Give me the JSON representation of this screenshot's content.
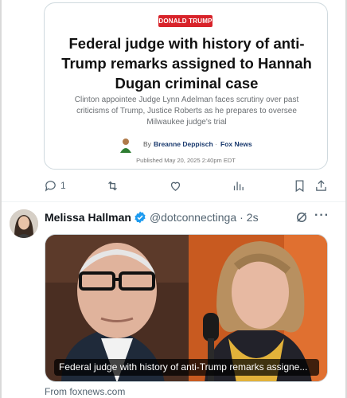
{
  "article": {
    "badge": "DONALD TRUMP",
    "headline": "Federal judge with history of anti-Trump remarks assigned to Hannah Dugan criminal case",
    "dek": "Clinton appointee Judge Lynn Adelman faces scrutiny over past criticisms of Trump, Justice Roberts as he prepares to oversee Milwaukee judge's trial",
    "by": "By",
    "author": "Breanne Deppisch",
    "separator": "·",
    "outlet": "Fox News",
    "published": "Published May 20, 2025 2:40pm EDT"
  },
  "actions": {
    "reply_count": "1",
    "icons": [
      "reply-icon",
      "retweet-icon",
      "like-icon",
      "views-icon",
      "bookmark-icon",
      "share-icon"
    ]
  },
  "tweet": {
    "name": "Melissa Hallman",
    "handle": "@dotconnectinga",
    "separator": "·",
    "time": "2s",
    "media_caption": "Federal judge with history of anti-Trump remarks assigne...",
    "source": "From foxnews.com"
  },
  "colors": {
    "badge_red": "#d8232a",
    "fox_blue": "#1a3a6e",
    "verified_blue": "#1d9bf0",
    "muted": "#536471"
  }
}
